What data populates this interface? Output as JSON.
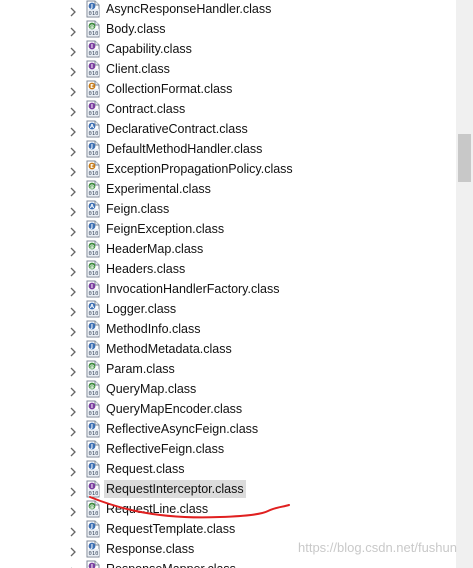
{
  "tree": {
    "items": [
      {
        "label": "AsyncResponseHandler.class",
        "icon": "class-file-icon",
        "badge": "J"
      },
      {
        "label": "Body.class",
        "icon": "annotation-class-file-icon",
        "badge": "@"
      },
      {
        "label": "Capability.class",
        "icon": "interface-class-file-icon",
        "badge": "I"
      },
      {
        "label": "Client.class",
        "icon": "interface-class-file-icon",
        "badge": "I"
      },
      {
        "label": "CollectionFormat.class",
        "icon": "enum-class-file-icon",
        "badge": "E"
      },
      {
        "label": "Contract.class",
        "icon": "interface-class-file-icon",
        "badge": "I"
      },
      {
        "label": "DeclarativeContract.class",
        "icon": "abstract-class-file-icon",
        "badge": "A"
      },
      {
        "label": "DefaultMethodHandler.class",
        "icon": "class-file-icon",
        "badge": "J"
      },
      {
        "label": "ExceptionPropagationPolicy.class",
        "icon": "enum-class-file-icon",
        "badge": "E"
      },
      {
        "label": "Experimental.class",
        "icon": "annotation-class-file-icon",
        "badge": "@"
      },
      {
        "label": "Feign.class",
        "icon": "abstract-class-file-icon",
        "badge": "A"
      },
      {
        "label": "FeignException.class",
        "icon": "class-file-icon",
        "badge": "J"
      },
      {
        "label": "HeaderMap.class",
        "icon": "annotation-class-file-icon",
        "badge": "@"
      },
      {
        "label": "Headers.class",
        "icon": "annotation-class-file-icon",
        "badge": "@"
      },
      {
        "label": "InvocationHandlerFactory.class",
        "icon": "interface-class-file-icon",
        "badge": "I"
      },
      {
        "label": "Logger.class",
        "icon": "abstract-class-file-icon",
        "badge": "A"
      },
      {
        "label": "MethodInfo.class",
        "icon": "class-file-icon",
        "badge": "J"
      },
      {
        "label": "MethodMetadata.class",
        "icon": "class-file-icon",
        "badge": "J"
      },
      {
        "label": "Param.class",
        "icon": "annotation-class-file-icon",
        "badge": "@"
      },
      {
        "label": "QueryMap.class",
        "icon": "annotation-class-file-icon",
        "badge": "@"
      },
      {
        "label": "QueryMapEncoder.class",
        "icon": "interface-class-file-icon",
        "badge": "I"
      },
      {
        "label": "ReflectiveAsyncFeign.class",
        "icon": "class-file-icon",
        "badge": "J"
      },
      {
        "label": "ReflectiveFeign.class",
        "icon": "class-file-icon",
        "badge": "J"
      },
      {
        "label": "Request.class",
        "icon": "class-file-icon",
        "badge": "J"
      },
      {
        "label": "RequestInterceptor.class",
        "icon": "interface-class-file-icon",
        "badge": "I",
        "selected": true
      },
      {
        "label": "RequestLine.class",
        "icon": "annotation-class-file-icon",
        "badge": "@"
      },
      {
        "label": "RequestTemplate.class",
        "icon": "class-file-icon",
        "badge": "J"
      },
      {
        "label": "Response.class",
        "icon": "class-file-icon",
        "badge": "J"
      },
      {
        "label": "ResponseMapper.class",
        "icon": "interface-class-file-icon",
        "badge": "I"
      }
    ]
  },
  "watermark": "https://blog.csdn.net/fushun",
  "colors": {
    "selection": "#dcdcdc",
    "annotation_red": "#e02020",
    "class_blue": "#3d6fb3",
    "annotation_green": "#3a8a3a",
    "interface_purple": "#7a3fa0",
    "enum_orange": "#c57a17"
  }
}
